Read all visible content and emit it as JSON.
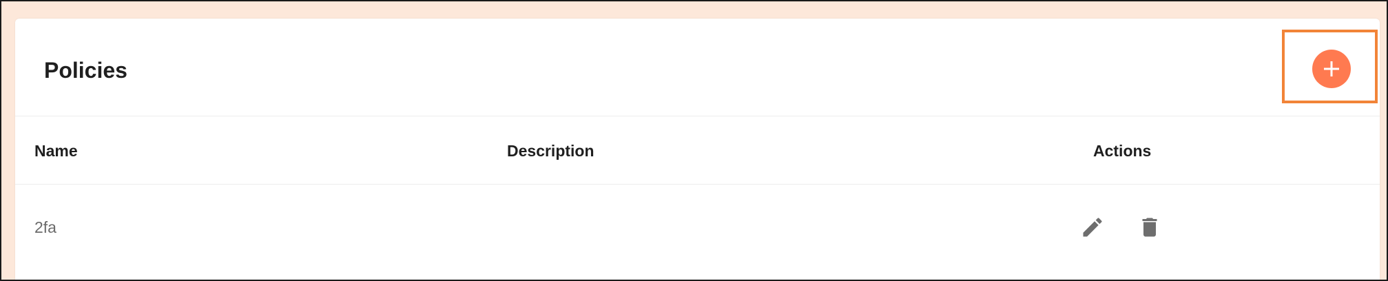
{
  "header": {
    "title": "Policies",
    "add_button_icon": "plus-icon",
    "accent_color": "#ff7a50"
  },
  "table": {
    "columns": [
      "Name",
      "Description",
      "Actions"
    ],
    "rows": [
      {
        "name": "2fa",
        "description": "",
        "actions": [
          "edit-icon",
          "delete-icon"
        ]
      }
    ]
  },
  "colors": {
    "background": "#fde8da",
    "highlight": "#f28438",
    "icon": "#6e6e6e"
  }
}
